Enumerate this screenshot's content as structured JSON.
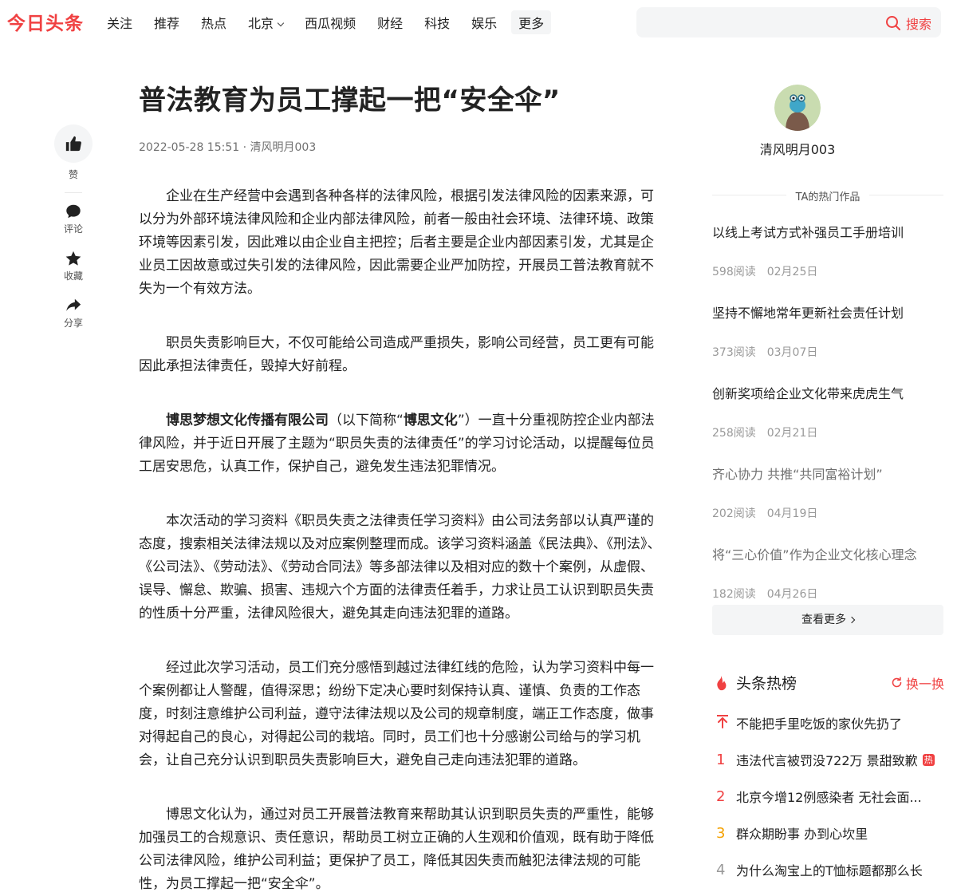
{
  "header": {
    "logo": "今日头条",
    "nav": [
      "关注",
      "推荐",
      "热点",
      "北京",
      "西瓜视频",
      "财经",
      "科技",
      "娱乐",
      "更多"
    ],
    "search_placeholder": "",
    "search_label": "搜索"
  },
  "rail": {
    "like": "赞",
    "comment": "评论",
    "favorite": "收藏",
    "share": "分享"
  },
  "article": {
    "title": "普法教育为员工撑起一把“安全伞”",
    "meta": "2022-05-28 15:51 · 清风明月003",
    "p1": "企业在生产经营中会遇到各种各样的法律风险，根据引发法律风险的因素来源，可以分为外部环境法律风险和企业内部法律风险，前者一般由社会环境、法律环境、政策环境等因素引发，因此难以由企业自主把控；后者主要是企业内部因素引发，尤其是企业员工因故意或过失引发的法律风险，因此需要企业严加防控，开展员工普法教育就不失为一个有效方法。",
    "p2": "职员失责影响巨大，不仅可能给公司造成严重损失，影响公司经营，员工更有可能因此承担法律责任，毁掉大好前程。",
    "p3_bold1": "博思梦想文化传播有限公司",
    "p3_mid": "（以下简称“",
    "p3_bold2": "博思文化",
    "p3_rest": "”）一直十分重视防控企业内部法律风险，并于近日开展了主题为“职员失责的法律责任”的学习讨论活动，以提醒每位员工居安思危，认真工作，保护自己，避免发生违法犯罪情况。",
    "p4": "本次活动的学习资料《职员失责之法律责任学习资料》由公司法务部以认真严谨的态度，搜索相关法律法规以及对应案例整理而成。该学习资料涵盖《民法典》、《刑法》、《公司法》、《劳动法》、《劳动合同法》等多部法律以及相对应的数十个案例，从虚假、误导、懈怠、欺骗、损害、违规六个方面的法律责任着手，力求让员工认识到职员失责的性质十分严重，法律风险很大，避免其走向违法犯罪的道路。",
    "p5": "经过此次学习活动，员工们充分感悟到越过法律红线的危险，认为学习资料中每一个案例都让人警醒，值得深思；纷纷下定决心要时刻保持认真、谨慎、负责的工作态度，时刻注意维护公司利益，遵守法律法规以及公司的规章制度，端正工作态度，做事对得起自己的良心，对得起公司的栽培。同时，员工们也十分感谢公司给与的学习机会，让自己充分认识到职员失责影响巨大，避免自己走向违法犯罪的道路。",
    "p6": "博思文化认为，通过对员工开展普法教育来帮助其认识到职员失责的严重性，能够加强员工的合规意识、责任意识，帮助员工树立正确的人生观和价值观，既有助于降低公司法律风险，维护公司利益；更保护了员工，降低其因失责而触犯法律法规的可能性，为员工撑起一把“安全伞”。"
  },
  "sidebar": {
    "author_name": "清风明月003",
    "hot_works_title": "TA的热门作品",
    "works": [
      {
        "title": "以线上考试方式补强员工手册培训",
        "reads": "598阅读",
        "date": "02月25日"
      },
      {
        "title": "坚持不懈地常年更新社会责任计划",
        "reads": "373阅读",
        "date": "03月07日"
      },
      {
        "title": "创新奖项给企业文化带来虎虎生气",
        "reads": "258阅读",
        "date": "02月21日"
      },
      {
        "title": "齐心协力 共推“共同富裕计划”",
        "reads": "202阅读",
        "date": "04月19日"
      },
      {
        "title": "将“三心价值”作为企业文化核心理念",
        "reads": "182阅读",
        "date": "04月26日"
      }
    ],
    "more_label": "查看更多",
    "rank_title": "头条热榜",
    "refresh_label": "换一换",
    "rank": [
      {
        "num": "",
        "title": "不能把手里吃饭的家伙先扔了",
        "badge": ""
      },
      {
        "num": "1",
        "title": "违法代言被罚没722万 景甜致歉",
        "badge": "热"
      },
      {
        "num": "2",
        "title": "北京今增12例感染者 无社会面...",
        "badge": ""
      },
      {
        "num": "3",
        "title": "群众期盼事 办到心坎里",
        "badge": ""
      },
      {
        "num": "4",
        "title": "为什么淘宝上的T恤标题都那么长",
        "badge": ""
      }
    ]
  }
}
